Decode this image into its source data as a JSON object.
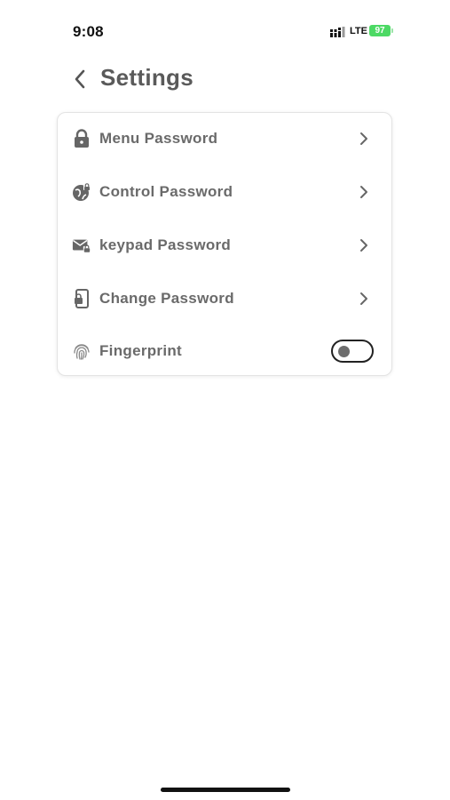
{
  "status_bar": {
    "time": "9:08",
    "network": "LTE",
    "battery_level": "97",
    "battery_color": "#4cd964"
  },
  "header": {
    "back_icon": "chevron-left-icon",
    "title": "Settings"
  },
  "settings": {
    "items": [
      {
        "label": "Menu Password",
        "icon": "lock-icon",
        "action": "chevron"
      },
      {
        "label": "Control Password",
        "icon": "globe-lock-icon",
        "action": "chevron"
      },
      {
        "label": "keypad Password",
        "icon": "mail-lock-icon",
        "action": "chevron"
      },
      {
        "label": "Change Password",
        "icon": "phone-lock-icon",
        "action": "chevron"
      },
      {
        "label": "Fingerprint",
        "icon": "fingerprint-icon",
        "action": "toggle",
        "enabled": false
      }
    ]
  },
  "colors": {
    "text": "#6a6a6a",
    "title": "#5a5a5a",
    "icon": "#666666",
    "toggle_border": "#222222",
    "card_border": "#e3e3e3"
  }
}
